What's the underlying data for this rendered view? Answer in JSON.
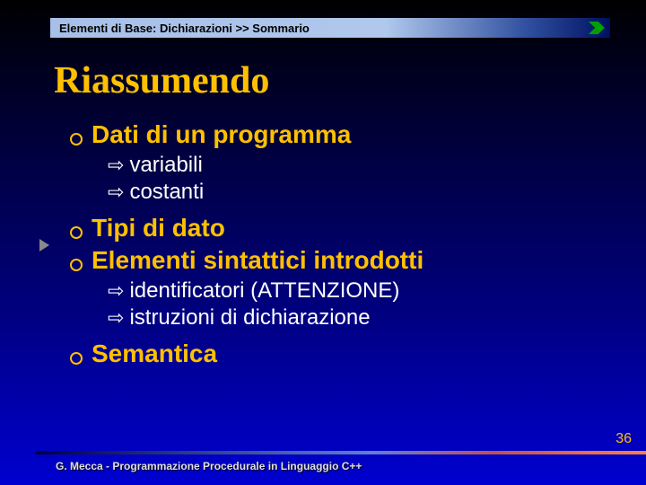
{
  "header": {
    "breadcrumb": "Elementi di Base: Dichiarazioni >> Sommario"
  },
  "title": "Riassumendo",
  "bullets": {
    "b1": "Dati di un programma",
    "b1s1": "variabili",
    "b1s2": "costanti",
    "b2": "Tipi di dato",
    "b3": "Elementi sintattici introdotti",
    "b3s1": "identificatori (ATTENZIONE)",
    "b3s2": "istruzioni di dichiarazione",
    "b4": "Semantica"
  },
  "footer": {
    "author": "G. Mecca - Programmazione Procedurale in Linguaggio C++",
    "page": "36"
  }
}
